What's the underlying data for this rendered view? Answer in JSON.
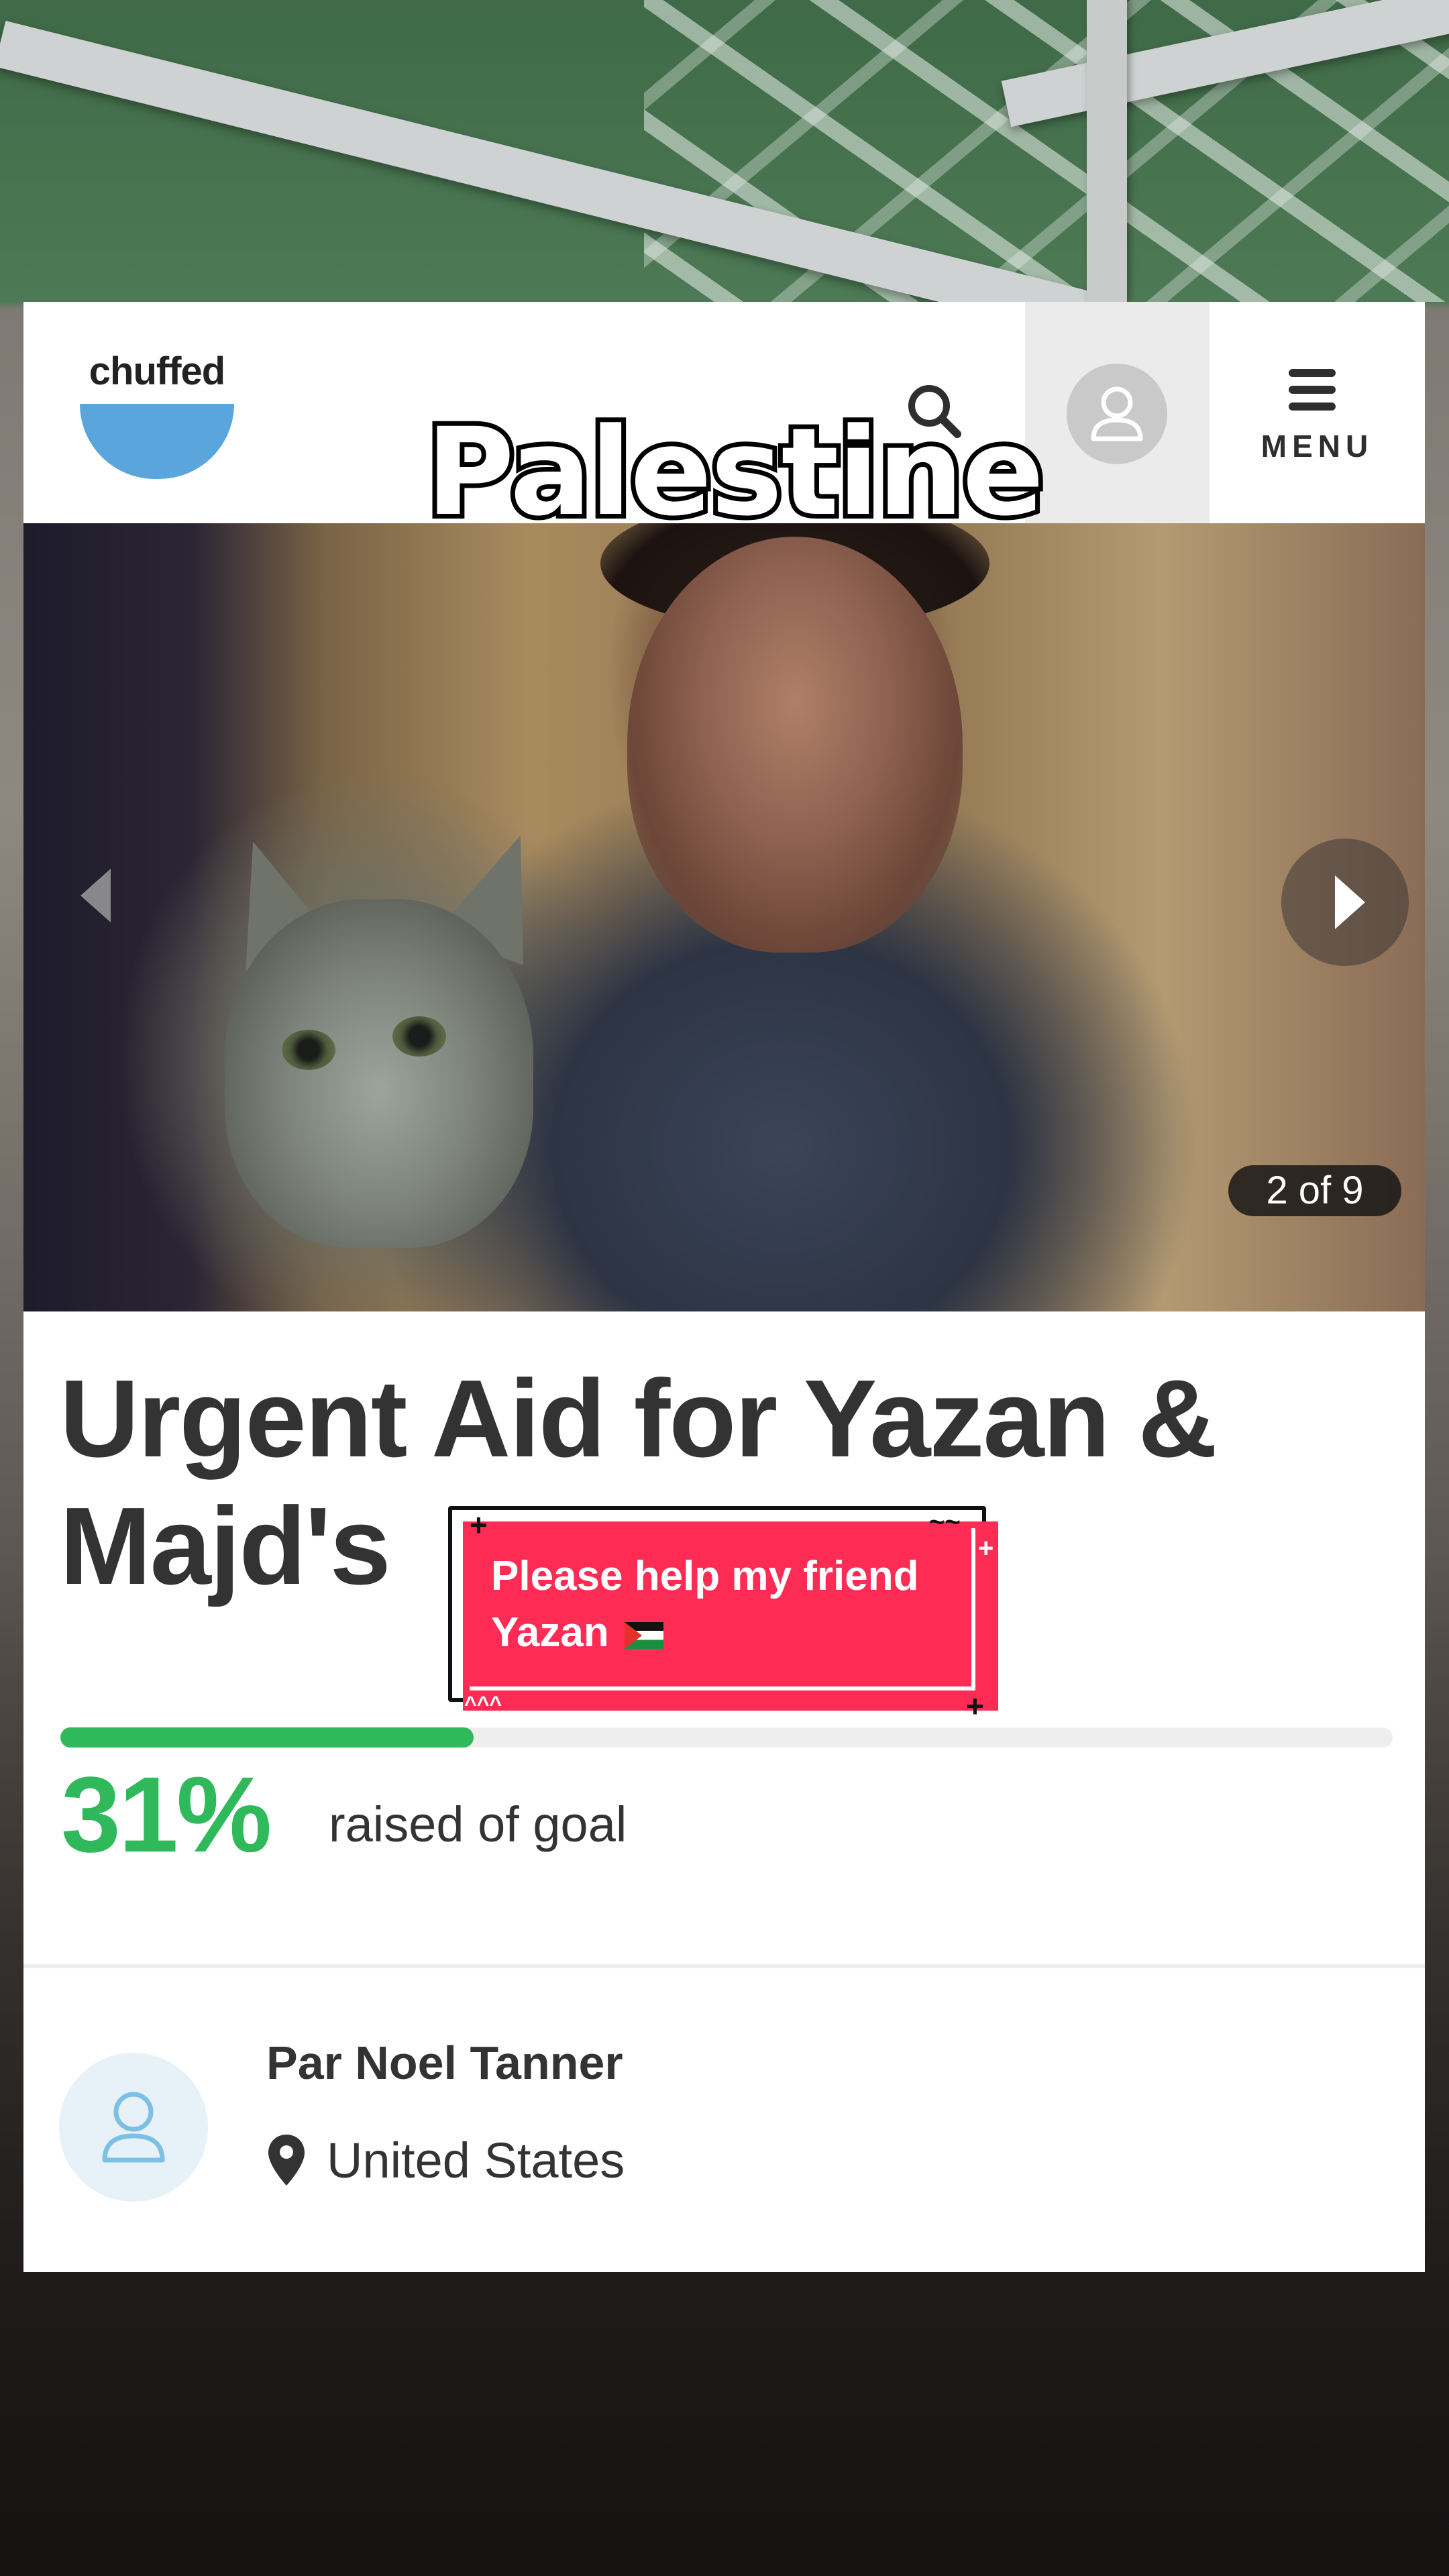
{
  "header": {
    "logo_text": "chuffed",
    "menu_label": "MENU"
  },
  "overlay": {
    "title": "Palestine",
    "sticker_text": "Please help my friend Yazan"
  },
  "carousel": {
    "counter": "2 of 9"
  },
  "campaign": {
    "title": "Urgent Aid for Yazan & Majd's",
    "percent_text": "31%",
    "percent_value": 31,
    "caption": "raised of goal"
  },
  "organizer": {
    "name": "Par Noel Tanner",
    "location": "United States"
  },
  "colors": {
    "accent_green": "#2fb95b",
    "sticker_red": "#fe2c55",
    "logo_blue": "#5aa6dc"
  },
  "icons": [
    "search-icon",
    "user-icon",
    "menu-icon",
    "chevron-left-icon",
    "chevron-right-icon",
    "location-pin-icon",
    "palestine-flag-icon"
  ]
}
